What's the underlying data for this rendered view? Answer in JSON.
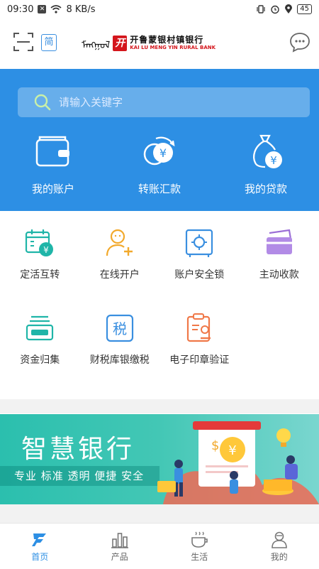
{
  "status_bar": {
    "time": "09:30",
    "net_speed": "8 KB/s",
    "battery": "45"
  },
  "header": {
    "simplified_label": "简",
    "logo_mongolian": "ᠮᠠᠩᠭᠣᠯ",
    "logo_mark": "开",
    "logo_cn": "开鲁蒙银村镇银行",
    "logo_en": "KAI LU MENG YIN RURAL BANK"
  },
  "search": {
    "placeholder": "请输入关键字"
  },
  "hero": {
    "items": [
      {
        "label": "我的账户",
        "icon": "wallet-icon"
      },
      {
        "label": "转账汇款",
        "icon": "transfer-icon"
      },
      {
        "label": "我的贷款",
        "icon": "loan-icon"
      }
    ]
  },
  "grid": {
    "items": [
      {
        "label": "定活互转",
        "icon": "calendar-yen-icon"
      },
      {
        "label": "在线开户",
        "icon": "add-user-icon"
      },
      {
        "label": "账户安全锁",
        "icon": "safe-icon"
      },
      {
        "label": "主动收款",
        "icon": "cards-icon"
      },
      {
        "label": "资金归集",
        "icon": "tray-icon"
      },
      {
        "label": "财税库银缴税",
        "icon": "tax-icon"
      },
      {
        "label": "电子印章验证",
        "icon": "seal-icon"
      }
    ]
  },
  "banner": {
    "title": "智慧银行",
    "subtitle": "专业 标准 透明 便捷 安全"
  },
  "tabbar": {
    "items": [
      {
        "label": "首页",
        "icon": "home-logo-icon",
        "active": true
      },
      {
        "label": "产品",
        "icon": "products-icon",
        "active": false
      },
      {
        "label": "生活",
        "icon": "life-cup-icon",
        "active": false
      },
      {
        "label": "我的",
        "icon": "profile-icon",
        "active": false
      }
    ]
  },
  "colors": {
    "primary": "#2d8fe4",
    "banner": "#2bbfae",
    "brand_red": "#d4161c"
  }
}
